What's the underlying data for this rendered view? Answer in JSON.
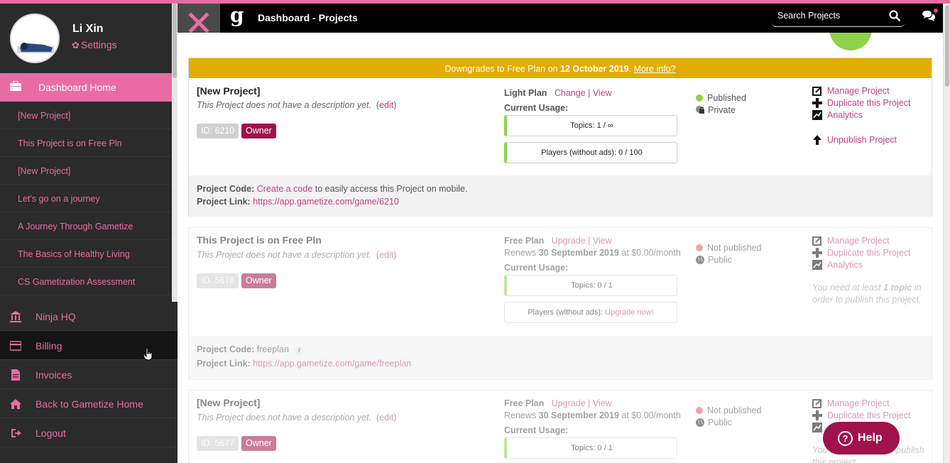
{
  "user": {
    "name": "Li Xin",
    "settings_label": "Settings"
  },
  "sidebar": {
    "dashboard_home": "Dashboard Home",
    "projects": [
      "[New Project]",
      "This Project is on Free Pln",
      "[New Project]",
      "Let's go on a journey",
      "A Journey Through Gametize",
      "The Basics of Healthy Living",
      "CS Gametization Assessment"
    ],
    "nav": [
      {
        "label": "Ninja HQ",
        "icon": "bank-icon"
      },
      {
        "label": "Billing",
        "icon": "credit-card-icon"
      },
      {
        "label": "Invoices",
        "icon": "document-icon"
      },
      {
        "label": "Back to Gametize Home",
        "icon": "home-icon"
      },
      {
        "label": "Logout",
        "icon": "logout-icon"
      }
    ]
  },
  "header": {
    "logo": "g",
    "title": "Dashboard - Projects",
    "search_placeholder": "Search Projects"
  },
  "colors": {
    "accent": "#e86ca2",
    "banner": "#e2ad00",
    "badge_owner": "#a0124b",
    "published": "#8ed34a",
    "not_published": "#e0586f"
  },
  "cards": [
    {
      "banner": {
        "prefix": "Downgrades to Free Plan on ",
        "date": "12 October 2019",
        "suffix": ". ",
        "link": "More info?"
      },
      "title": "[New Project]",
      "description": "This Project does not have a description yet.",
      "edit": "edit",
      "id_badge": "ID: 6210",
      "owner_badge": "Owner",
      "plan_name": "Light Plan",
      "plan_links": "Change | View",
      "usage_label": "Current Usage:",
      "topics": "Topics: 1 / ∞",
      "players": "Players (without ads): 0 / 100",
      "status_published": "Published",
      "status_visibility": "Private",
      "actions": [
        "Manage Project",
        "Duplicate this Project",
        "Analytics",
        "Unpublish Project"
      ],
      "code_label": "Project Code:",
      "code_link": "Create a code",
      "code_suffix": " to easily access this Project on mobile.",
      "link_label": "Project Link:",
      "link_url": "https://app.gametize.com/game/6210"
    },
    {
      "title": "This Project is on Free Pln",
      "description": "This Project does not have a description yet.",
      "edit": "edit",
      "id_badge": "ID: 5678",
      "owner_badge": "Owner",
      "plan_name": "Free Plan",
      "plan_links": "Upgrade | View",
      "renews_prefix": "Renews ",
      "renews_date": "30 September 2019",
      "renews_suffix": " at $0.00/month",
      "usage_label": "Current Usage:",
      "topics": "Topics: 0 / 1",
      "players_prefix": "Players (without ads): ",
      "players_link": "Upgrade now!",
      "status_published": "Not published",
      "status_visibility": "Public",
      "actions": [
        "Manage Project",
        "Duplicate this Project",
        "Analytics"
      ],
      "note_prefix": "You need at least ",
      "note_bold": "1 topic",
      "note_suffix": " in order to publish this project.",
      "code_label": "Project Code:",
      "code_value": "freeplan",
      "link_label": "Project Link:",
      "link_url": "https://app.gametize.com/game/freeplan"
    },
    {
      "title": "[New Project]",
      "description": "This Project does not have a description yet.",
      "edit": "edit",
      "id_badge": "ID: 5677",
      "owner_badge": "Owner",
      "plan_name": "Free Plan",
      "plan_links": "Upgrade | View",
      "renews_prefix": "Renews ",
      "renews_date": "30 September 2019",
      "renews_suffix": " at $0.00/month",
      "usage_label": "Current Usage:",
      "topics": "Topics: 0 / 1",
      "status_published": "Not published",
      "status_visibility": "Public",
      "actions": [
        "Manage Project",
        "Duplicate this Project"
      ],
      "note_prefix": "You",
      "note_bold": "topic",
      "note_suffix": " in order to publish this project."
    }
  ],
  "help": {
    "label": "Help",
    "icon": "question-circle-icon"
  }
}
